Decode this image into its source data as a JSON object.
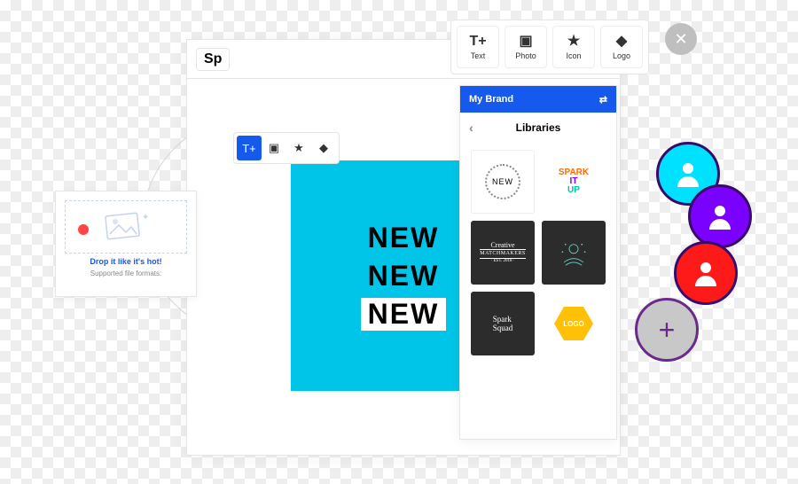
{
  "app": {
    "logo": "Sp"
  },
  "close_label": "✕",
  "top_tools": [
    {
      "name": "text-tool",
      "glyph": "T+",
      "label": "Text"
    },
    {
      "name": "photo-tool",
      "glyph": "▣",
      "label": "Photo"
    },
    {
      "name": "icon-tool",
      "glyph": "★",
      "label": "Icon"
    },
    {
      "name": "logo-tool",
      "glyph": "◆",
      "label": "Logo"
    }
  ],
  "mini_tools": [
    {
      "name": "mini-text",
      "glyph": "T+",
      "active": true
    },
    {
      "name": "mini-image",
      "glyph": "▣",
      "active": false
    },
    {
      "name": "mini-star",
      "glyph": "★",
      "active": false
    },
    {
      "name": "mini-shape",
      "glyph": "◆",
      "active": false
    }
  ],
  "artwork": {
    "lines": [
      "NEW",
      "NEW",
      "NEW"
    ]
  },
  "panel": {
    "header": "My Brand",
    "section": "Libraries",
    "items": [
      {
        "name": "lib-new",
        "label": "NEW"
      },
      {
        "name": "lib-spark-it-up",
        "label_lines": [
          "SPARK",
          "IT",
          "UP"
        ]
      },
      {
        "name": "lib-matchmakers",
        "label_lines": [
          "Creative",
          "MATCHMAKERS",
          "· EST. 2018 ·"
        ]
      },
      {
        "name": "lib-hands",
        "label": ""
      },
      {
        "name": "lib-spark-squad",
        "label_lines": [
          "Spark",
          "Squad"
        ]
      },
      {
        "name": "lib-logo-hex",
        "label": "LOGO"
      }
    ]
  },
  "drop_card": {
    "title": "Drop it like it's hot!",
    "subtitle": "Supported file formats:"
  },
  "avatars": {
    "add_glyph": "+"
  }
}
